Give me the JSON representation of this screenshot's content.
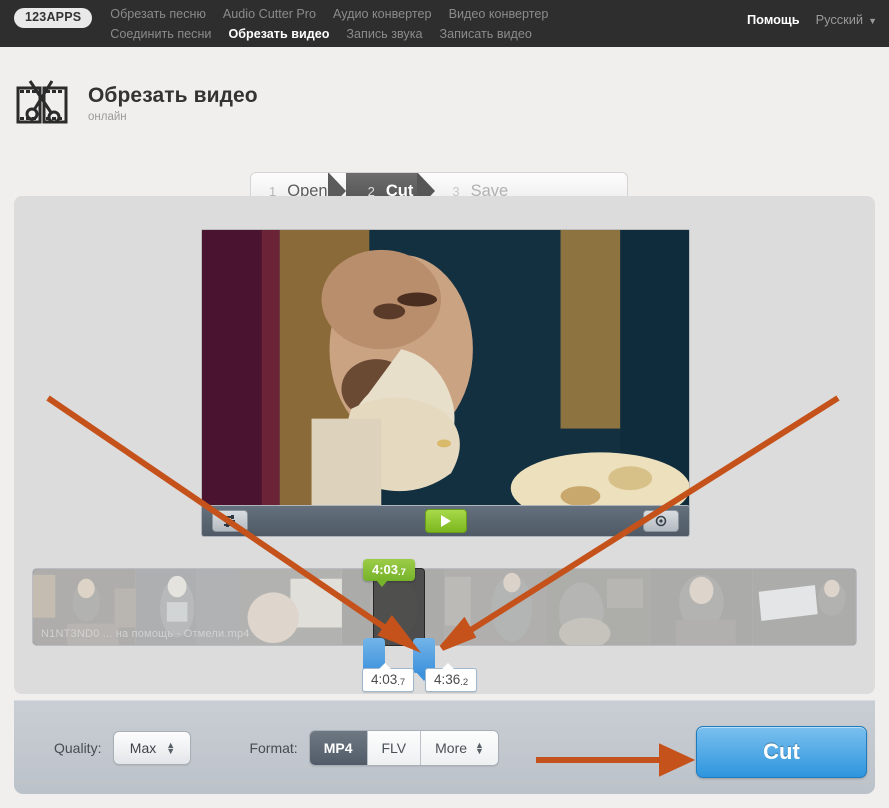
{
  "nav": {
    "logo": "123APPS",
    "links": [
      {
        "label": "Обрезать песню",
        "active": false
      },
      {
        "label": "Audio Cutter Pro",
        "active": false
      },
      {
        "label": "Аудио конвертер",
        "active": false
      },
      {
        "label": "Видео конвертер",
        "active": false
      },
      {
        "label": "Соединить песни",
        "active": false
      },
      {
        "label": "Обрезать видео",
        "active": true
      },
      {
        "label": "Запись звука",
        "active": false
      },
      {
        "label": "Записать видео",
        "active": false
      }
    ],
    "help": "Помощь",
    "language": "Русский",
    "caret": "▼"
  },
  "header": {
    "title": "Обрезать видео",
    "subtitle": "онлайн",
    "icon": "film-scissors-icon"
  },
  "steps": [
    {
      "num": "1",
      "label": "Open",
      "state": "done"
    },
    {
      "num": "2",
      "label": "Cut",
      "state": "active"
    },
    {
      "num": "3",
      "label": "Save",
      "state": "future"
    }
  ],
  "player": {
    "controls": {
      "settings_icon": "crop-settings-icon",
      "play_icon": "play-icon",
      "volume_icon": "mute-icon"
    }
  },
  "timeline": {
    "filename": "N1NT3ND0 ... на помощь - Отмели.mp4",
    "tooltip_time": "4:03",
    "tooltip_frac": ".7",
    "start_time": "4:03",
    "start_frac": ".7",
    "end_time": "4:36",
    "end_frac": ".2",
    "start_handle": "trim-start-handle",
    "end_handle": "trim-end-handle"
  },
  "bottom": {
    "quality_label": "Quality:",
    "quality_value": "Max",
    "format_label": "Format:",
    "formats": [
      {
        "label": "MP4",
        "active": true
      },
      {
        "label": "FLV",
        "active": false
      },
      {
        "label": "More",
        "active": false,
        "stepper": true
      }
    ],
    "cut_button": "Cut"
  },
  "colors": {
    "nav_bg": "#2e2e2e",
    "page_bg": "#f0efee",
    "panel_bg": "#dddcdc",
    "bottom_bar": "#c6ccd2",
    "accent_blue": "#2e95dd",
    "accent_green": "#7cb71e",
    "annotation_orange": "#c4521a",
    "handle_blue": "#3f93dd"
  },
  "annotations": {
    "arrows": "four orange arrows pointing to trim handles and Cut button"
  }
}
